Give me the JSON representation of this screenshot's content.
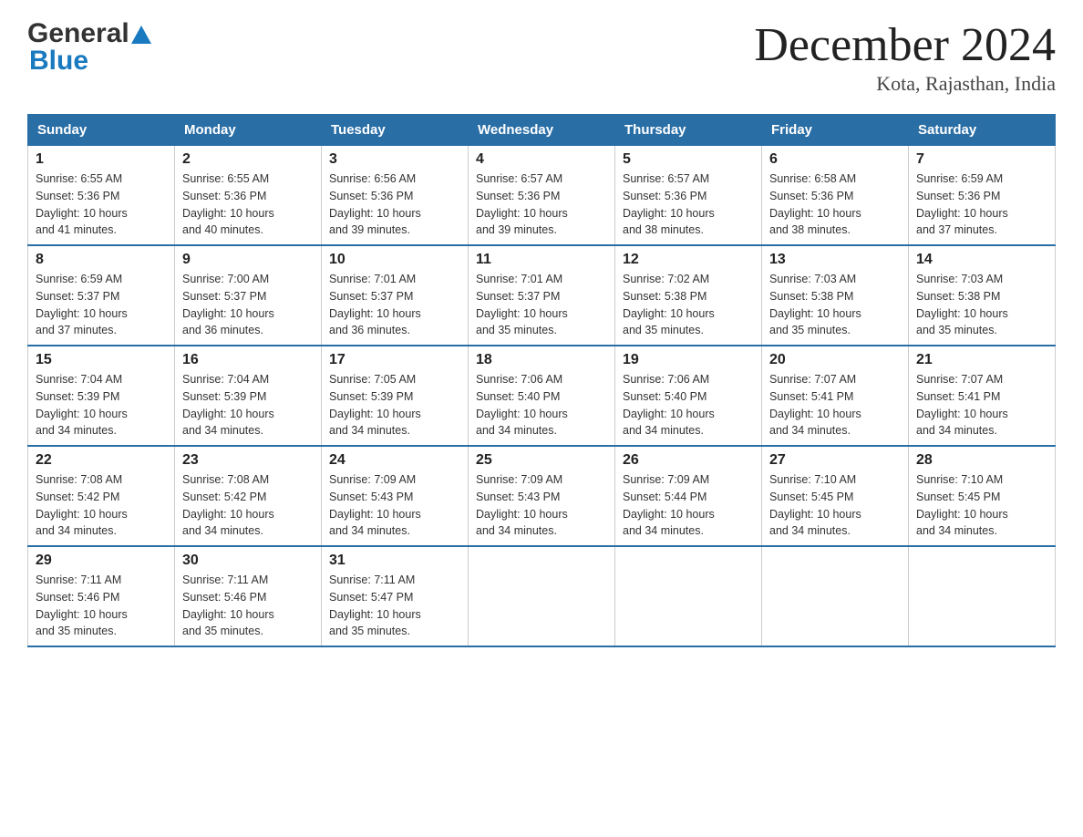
{
  "logo": {
    "general": "General",
    "blue": "Blue",
    "triangle": "▲"
  },
  "title": "December 2024",
  "subtitle": "Kota, Rajasthan, India",
  "days_of_week": [
    "Sunday",
    "Monday",
    "Tuesday",
    "Wednesday",
    "Thursday",
    "Friday",
    "Saturday"
  ],
  "weeks": [
    [
      {
        "day": "1",
        "info": "Sunrise: 6:55 AM\nSunset: 5:36 PM\nDaylight: 10 hours\nand 41 minutes."
      },
      {
        "day": "2",
        "info": "Sunrise: 6:55 AM\nSunset: 5:36 PM\nDaylight: 10 hours\nand 40 minutes."
      },
      {
        "day": "3",
        "info": "Sunrise: 6:56 AM\nSunset: 5:36 PM\nDaylight: 10 hours\nand 39 minutes."
      },
      {
        "day": "4",
        "info": "Sunrise: 6:57 AM\nSunset: 5:36 PM\nDaylight: 10 hours\nand 39 minutes."
      },
      {
        "day": "5",
        "info": "Sunrise: 6:57 AM\nSunset: 5:36 PM\nDaylight: 10 hours\nand 38 minutes."
      },
      {
        "day": "6",
        "info": "Sunrise: 6:58 AM\nSunset: 5:36 PM\nDaylight: 10 hours\nand 38 minutes."
      },
      {
        "day": "7",
        "info": "Sunrise: 6:59 AM\nSunset: 5:36 PM\nDaylight: 10 hours\nand 37 minutes."
      }
    ],
    [
      {
        "day": "8",
        "info": "Sunrise: 6:59 AM\nSunset: 5:37 PM\nDaylight: 10 hours\nand 37 minutes."
      },
      {
        "day": "9",
        "info": "Sunrise: 7:00 AM\nSunset: 5:37 PM\nDaylight: 10 hours\nand 36 minutes."
      },
      {
        "day": "10",
        "info": "Sunrise: 7:01 AM\nSunset: 5:37 PM\nDaylight: 10 hours\nand 36 minutes."
      },
      {
        "day": "11",
        "info": "Sunrise: 7:01 AM\nSunset: 5:37 PM\nDaylight: 10 hours\nand 35 minutes."
      },
      {
        "day": "12",
        "info": "Sunrise: 7:02 AM\nSunset: 5:38 PM\nDaylight: 10 hours\nand 35 minutes."
      },
      {
        "day": "13",
        "info": "Sunrise: 7:03 AM\nSunset: 5:38 PM\nDaylight: 10 hours\nand 35 minutes."
      },
      {
        "day": "14",
        "info": "Sunrise: 7:03 AM\nSunset: 5:38 PM\nDaylight: 10 hours\nand 35 minutes."
      }
    ],
    [
      {
        "day": "15",
        "info": "Sunrise: 7:04 AM\nSunset: 5:39 PM\nDaylight: 10 hours\nand 34 minutes."
      },
      {
        "day": "16",
        "info": "Sunrise: 7:04 AM\nSunset: 5:39 PM\nDaylight: 10 hours\nand 34 minutes."
      },
      {
        "day": "17",
        "info": "Sunrise: 7:05 AM\nSunset: 5:39 PM\nDaylight: 10 hours\nand 34 minutes."
      },
      {
        "day": "18",
        "info": "Sunrise: 7:06 AM\nSunset: 5:40 PM\nDaylight: 10 hours\nand 34 minutes."
      },
      {
        "day": "19",
        "info": "Sunrise: 7:06 AM\nSunset: 5:40 PM\nDaylight: 10 hours\nand 34 minutes."
      },
      {
        "day": "20",
        "info": "Sunrise: 7:07 AM\nSunset: 5:41 PM\nDaylight: 10 hours\nand 34 minutes."
      },
      {
        "day": "21",
        "info": "Sunrise: 7:07 AM\nSunset: 5:41 PM\nDaylight: 10 hours\nand 34 minutes."
      }
    ],
    [
      {
        "day": "22",
        "info": "Sunrise: 7:08 AM\nSunset: 5:42 PM\nDaylight: 10 hours\nand 34 minutes."
      },
      {
        "day": "23",
        "info": "Sunrise: 7:08 AM\nSunset: 5:42 PM\nDaylight: 10 hours\nand 34 minutes."
      },
      {
        "day": "24",
        "info": "Sunrise: 7:09 AM\nSunset: 5:43 PM\nDaylight: 10 hours\nand 34 minutes."
      },
      {
        "day": "25",
        "info": "Sunrise: 7:09 AM\nSunset: 5:43 PM\nDaylight: 10 hours\nand 34 minutes."
      },
      {
        "day": "26",
        "info": "Sunrise: 7:09 AM\nSunset: 5:44 PM\nDaylight: 10 hours\nand 34 minutes."
      },
      {
        "day": "27",
        "info": "Sunrise: 7:10 AM\nSunset: 5:45 PM\nDaylight: 10 hours\nand 34 minutes."
      },
      {
        "day": "28",
        "info": "Sunrise: 7:10 AM\nSunset: 5:45 PM\nDaylight: 10 hours\nand 34 minutes."
      }
    ],
    [
      {
        "day": "29",
        "info": "Sunrise: 7:11 AM\nSunset: 5:46 PM\nDaylight: 10 hours\nand 35 minutes."
      },
      {
        "day": "30",
        "info": "Sunrise: 7:11 AM\nSunset: 5:46 PM\nDaylight: 10 hours\nand 35 minutes."
      },
      {
        "day": "31",
        "info": "Sunrise: 7:11 AM\nSunset: 5:47 PM\nDaylight: 10 hours\nand 35 minutes."
      },
      {
        "day": "",
        "info": ""
      },
      {
        "day": "",
        "info": ""
      },
      {
        "day": "",
        "info": ""
      },
      {
        "day": "",
        "info": ""
      }
    ]
  ]
}
